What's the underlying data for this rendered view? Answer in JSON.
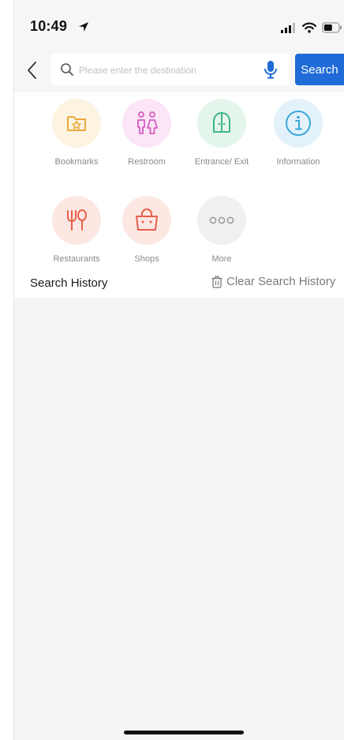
{
  "status_bar": {
    "time": "10:49"
  },
  "search": {
    "placeholder": "Please enter the destination",
    "button_label": "Search"
  },
  "categories": [
    {
      "label": "Bookmarks",
      "icon": "bookmark-folder-icon",
      "color": "#e9a93b",
      "bg": "#fdf3e1"
    },
    {
      "label": "Restroom",
      "icon": "restroom-icon",
      "color": "#d45bc3",
      "bg": "#fbe5f6"
    },
    {
      "label": "Entrance/ Exit",
      "icon": "door-icon",
      "color": "#3fb584",
      "bg": "#e4f6ec"
    },
    {
      "label": "Information",
      "icon": "info-icon",
      "color": "#3aa6d9",
      "bg": "#e3f2fa"
    },
    {
      "label": "Restaurants",
      "icon": "fork-spoon-icon",
      "color": "#e8604c",
      "bg": "#fde7e3"
    },
    {
      "label": "Shops",
      "icon": "shopping-bag-icon",
      "color": "#e8604c",
      "bg": "#fde7e3"
    },
    {
      "label": "More",
      "icon": "more-dots-icon",
      "color": "#9a9a9a",
      "bg": "#f0f0f0"
    }
  ],
  "history": {
    "title": "Search History",
    "clear_label": "Clear Search History"
  },
  "colors": {
    "accent": "#1f6bd8",
    "background": "#f6f6f6"
  }
}
